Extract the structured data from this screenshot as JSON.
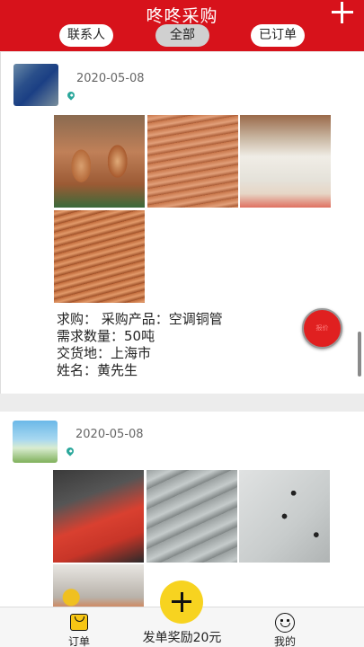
{
  "header": {
    "title": "咚咚采购",
    "tabs": [
      {
        "label": "联系人",
        "active": false
      },
      {
        "label": "全部",
        "active": true
      },
      {
        "label": "已订单",
        "active": false
      }
    ]
  },
  "posts": [
    {
      "date": "2020-05-08",
      "info": {
        "line1": "求购： 采购产品：空调铜管",
        "line2": "需求数量：50吨",
        "line3": "交货地：上海市",
        "line4": "姓名：黄先生"
      },
      "action_label": "报价"
    },
    {
      "date": "2020-05-08"
    }
  ],
  "bottom_nav": {
    "orders_label": "订单",
    "reward_label": "发单奖励20元",
    "mine_label": "我的"
  },
  "colors": {
    "brand_red": "#d7121b",
    "action_yellow": "#f7d320",
    "location_teal": "#2aa79b"
  }
}
